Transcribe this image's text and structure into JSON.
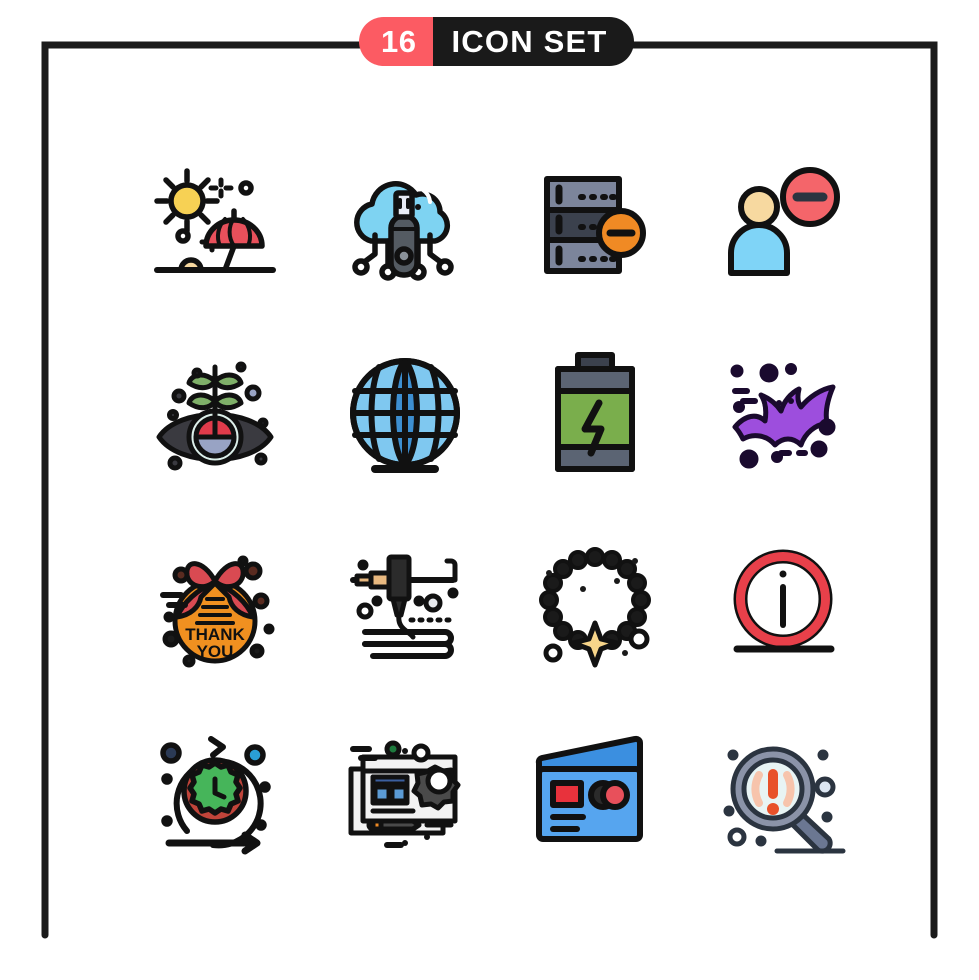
{
  "header": {
    "count": "16",
    "title": "ICON SET"
  },
  "colors": {
    "badge_count_bg": "#fc5b63",
    "badge_title_bg": "#1a1a1a",
    "badge_text": "#ffffff",
    "frame_stroke": "#1a1a1a",
    "outline": "#111111",
    "background": "#ffffff",
    "sun_yellow": "#f7d154",
    "umbrella_red": "#e8505b",
    "cloud_blue": "#7ed3f2",
    "usb_gray": "#545b62",
    "server_slate": "#7c859b",
    "server_dark": "#3b414d",
    "badge_orange": "#f08a24",
    "person_skin": "#f7d9a0",
    "person_body": "#7fd4f7",
    "remove_red": "#f4656a",
    "leaf_green": "#7fb069",
    "iris_blue": "#98a3c4",
    "iris_red": "#e03b4b",
    "eye_dark": "#3a3a40",
    "globe_blue_dark": "#3d8fd1",
    "globe_blue_light": "#7fc8f0",
    "battery_green": "#7aae4c",
    "battery_cap": "#5b6473",
    "bat_purple": "#9d4edd",
    "gift_orange": "#f09020",
    "gift_bow_red": "#e8505b",
    "printer_tan": "#e8b87f",
    "star_yellow": "#f7d58a",
    "info_red": "#e8404a",
    "gear_green": "#46b55a",
    "ring_red": "#c0443a",
    "node_blue": "#2a9fd6",
    "screen_gray": "#f2f2f2",
    "ui_blue": "#5b9bd5",
    "card_blue": "#56a5ef",
    "card_blue_dark": "#3b8fe0",
    "card_red": "#e8323c",
    "lens_gray": "#8b93a8",
    "lens_light": "#e8f4f4",
    "alert_orange": "#e8512a",
    "alert_peach": "#f7c4ac"
  },
  "icons": [
    {
      "index": 1,
      "name": "beach-summer-icon",
      "label": "Beach"
    },
    {
      "index": 2,
      "name": "cloud-usb-storage-icon",
      "label": "Cloud USB Storage"
    },
    {
      "index": 3,
      "name": "server-remove-icon",
      "label": "Remove Server"
    },
    {
      "index": 4,
      "name": "user-remove-icon",
      "label": "Remove User"
    },
    {
      "index": 5,
      "name": "eye-plant-vision-icon",
      "label": "Vision Growth"
    },
    {
      "index": 6,
      "name": "globe-icon",
      "label": "Globe"
    },
    {
      "index": 7,
      "name": "battery-charge-icon",
      "label": "Battery Charging"
    },
    {
      "index": 8,
      "name": "bat-icon",
      "label": "Bat"
    },
    {
      "index": 9,
      "name": "thank-you-gift-icon",
      "label": "Thank You"
    },
    {
      "index": 10,
      "name": "3d-printer-nozzle-icon",
      "label": "3D Printing"
    },
    {
      "index": 11,
      "name": "bead-bracelet-star-icon",
      "label": "Bracelet"
    },
    {
      "index": 12,
      "name": "information-sign-icon",
      "label": "Information"
    },
    {
      "index": 13,
      "name": "agile-cycle-clock-icon",
      "label": "Agile Cycle"
    },
    {
      "index": 14,
      "name": "web-design-window-icon",
      "label": "Web Design"
    },
    {
      "index": 15,
      "name": "credit-card-icon",
      "label": "Credit Card"
    },
    {
      "index": 16,
      "name": "search-alert-icon",
      "label": "Search Alert"
    }
  ],
  "icon_text": {
    "thank_you_line1": "THANK",
    "thank_you_line2": "YOU"
  }
}
